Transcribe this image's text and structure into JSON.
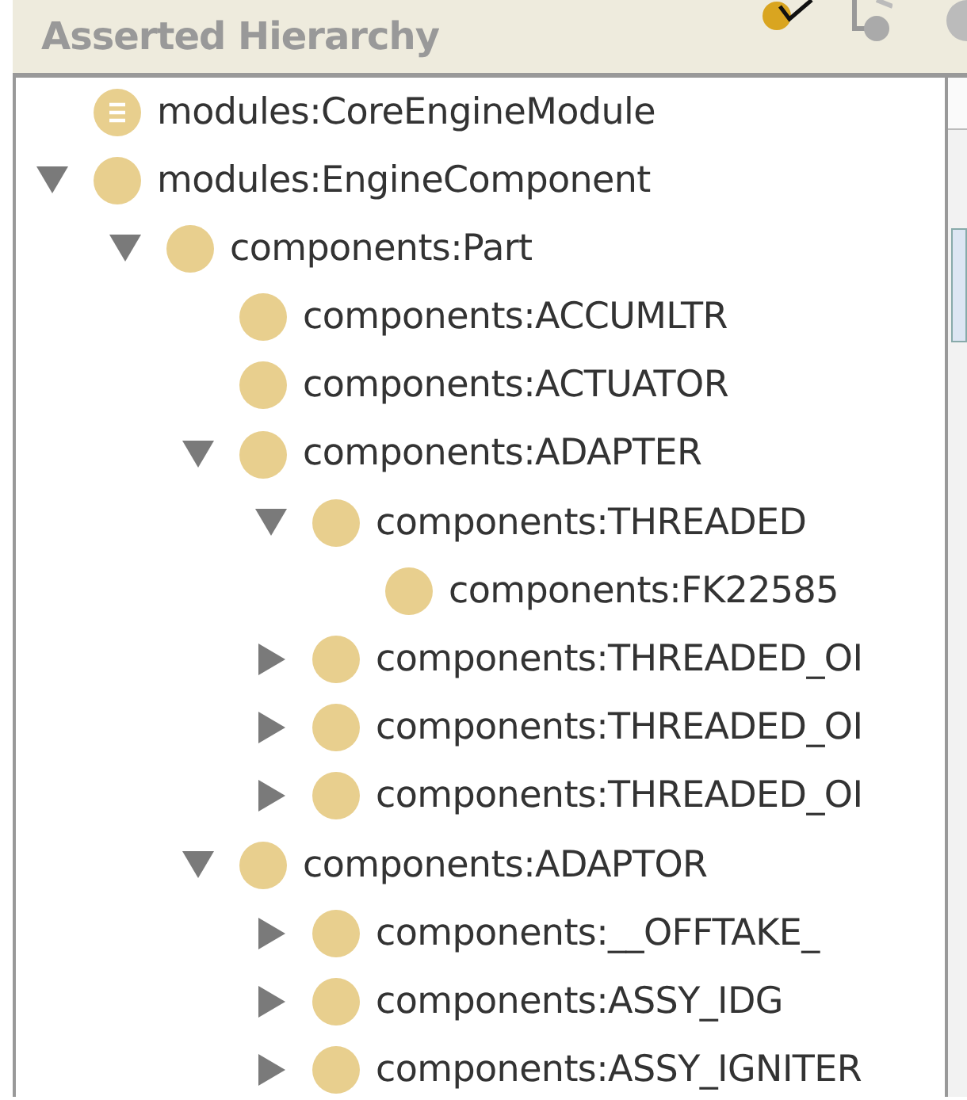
{
  "panel": {
    "title": "Asserted Hierarchy"
  },
  "tree": [
    {
      "kind": "ontology",
      "label": "modules:CoreEngineModule"
    },
    {
      "kind": "class",
      "label": "modules:EngineComponent",
      "expanded": true,
      "children": [
        {
          "kind": "class",
          "label": "components:Part",
          "expanded": true,
          "children": [
            {
              "kind": "class",
              "label": "components:ACCUMLTR"
            },
            {
              "kind": "class",
              "label": "components:ACTUATOR"
            },
            {
              "kind": "class",
              "label": "components:ADAPTER",
              "expanded": true,
              "children": [
                {
                  "kind": "class",
                  "label": "components:THREADED",
                  "expanded": true,
                  "children": [
                    {
                      "kind": "class",
                      "label": "components:FK22585"
                    }
                  ]
                },
                {
                  "kind": "class",
                  "label": "components:THREADED_OI",
                  "expanded": false
                },
                {
                  "kind": "class",
                  "label": "components:THREADED_OI",
                  "expanded": false
                },
                {
                  "kind": "class",
                  "label": "components:THREADED_OI",
                  "expanded": false
                }
              ]
            },
            {
              "kind": "class",
              "label": "components:ADAPTOR",
              "expanded": true,
              "children": [
                {
                  "kind": "class",
                  "label": "components:__OFFTAKE_",
                  "expanded": false
                },
                {
                  "kind": "class",
                  "label": "components:ASSY_IDG",
                  "expanded": false
                },
                {
                  "kind": "class",
                  "label": "components:ASSY_IGNITER",
                  "expanded": false
                }
              ]
            }
          ]
        }
      ]
    }
  ]
}
